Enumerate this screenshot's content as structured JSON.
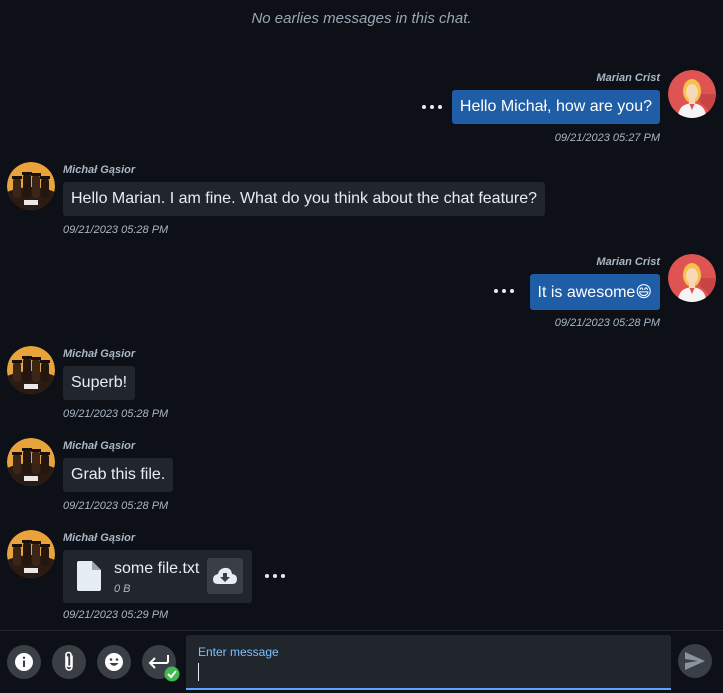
{
  "chat": {
    "notice": "No earlies messages in this chat.",
    "messages": [
      {
        "author": "Marian Crist",
        "text": "Hello Michał, how are you?",
        "time": "09/21/2023 05:27 PM",
        "direction": "out"
      },
      {
        "author": "Michał Gąsior",
        "text": "Hello Marian. I am fine. What do you think about the chat feature?",
        "time": "09/21/2023 05:28 PM",
        "direction": "in"
      },
      {
        "author": "Marian Crist",
        "text": "It is awesome😄",
        "time": "09/21/2023 05:28 PM",
        "direction": "out"
      },
      {
        "author": "Michał Gąsior",
        "text": "Superb!",
        "time": "09/21/2023 05:28 PM",
        "direction": "in"
      },
      {
        "author": "Michał Gąsior",
        "text": "Grab this file.",
        "time": "09/21/2023 05:28 PM",
        "direction": "in"
      },
      {
        "author": "Michał Gąsior",
        "file_name": "some file.txt",
        "file_size": "0 B",
        "time": "09/21/2023 05:29 PM",
        "direction": "in"
      }
    ]
  },
  "composer": {
    "label": "Enter message",
    "value": "",
    "buttons": [
      "info-icon",
      "attachment-icon",
      "emoji-icon",
      "enter-to-send-icon"
    ],
    "send_icon": "send-icon"
  },
  "colors": {
    "background": "#0d1117",
    "outgoing_bubble": "#1f5da6",
    "incoming_bubble": "#21262d",
    "accent": "#58a6ff",
    "success": "#3fb950"
  }
}
